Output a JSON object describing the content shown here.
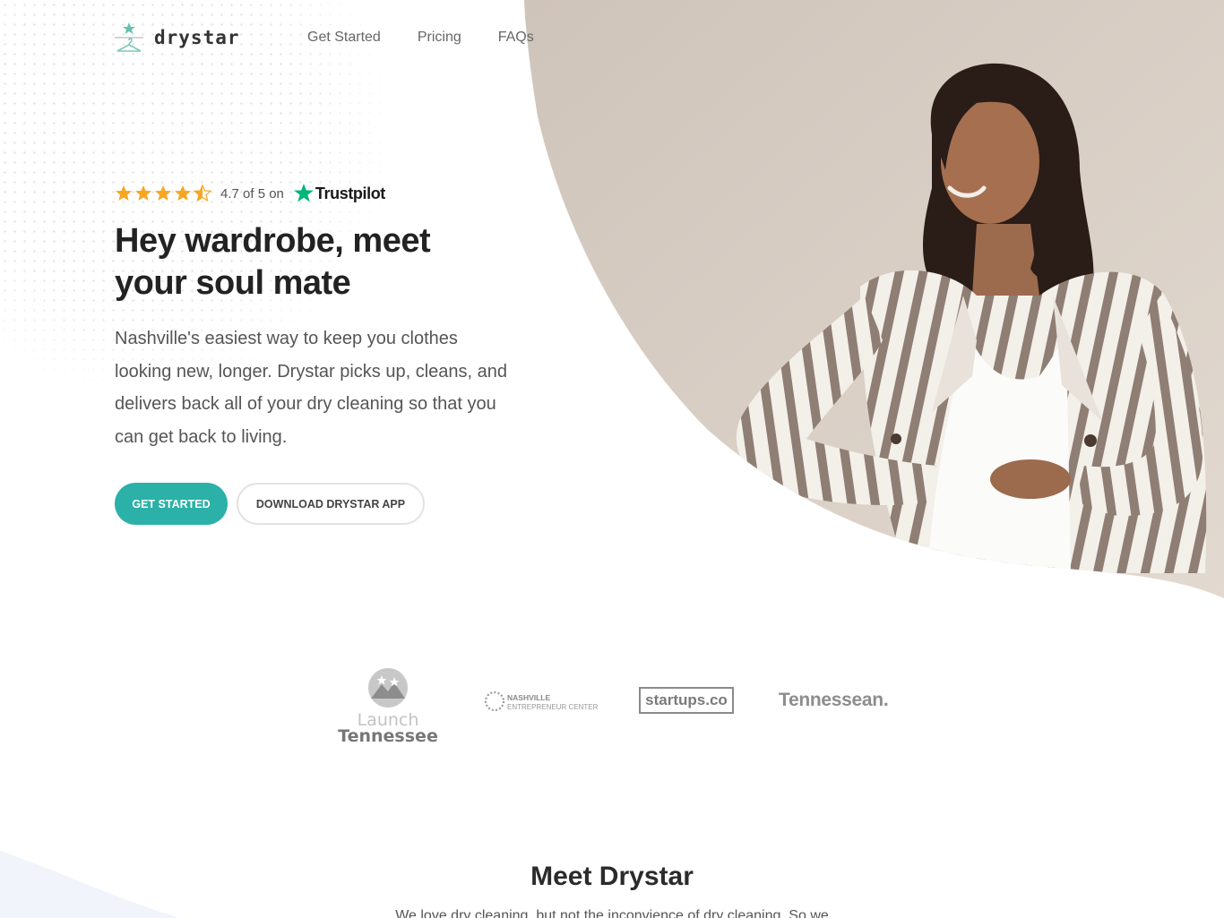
{
  "brand": {
    "name": "drystar",
    "accent": "#2bb1a7",
    "logo_icon": "hanger-star-icon"
  },
  "nav": {
    "items": [
      "Get Started",
      "Pricing",
      "FAQs"
    ]
  },
  "rating": {
    "stars": 4.5,
    "score_text": "4.7 of 5 on",
    "provider": "Trustpilot",
    "star_color": "#f6a623",
    "provider_color": "#00b67a"
  },
  "hero": {
    "headline": "Hey wardrobe, meet your soul mate",
    "description": "Nashville's easiest way to keep you clothes looking new, longer. Drystar picks up, cleans, and delivers back all of your dry cleaning so that you can get back to living.",
    "primary_cta": "GET STARTED",
    "secondary_cta": "DOWNLOAD DRYSTAR APP",
    "photo_bg": "#d9cec4"
  },
  "press_logos": [
    {
      "name": "launch-tennessee-logo",
      "lines": [
        "Launch",
        "Tennessee"
      ]
    },
    {
      "name": "nashville-entrepreneur-center-logo",
      "lines": [
        "NASHVILLE",
        "ENTREPRENEUR CENTER"
      ]
    },
    {
      "name": "startups-co-logo",
      "lines": [
        "startups.co"
      ]
    },
    {
      "name": "tennessean-logo",
      "lines": [
        "Tennessean."
      ]
    }
  ],
  "section": {
    "title": "Meet Drystar",
    "text": "We love dry cleaning, but not the inconvience of dry cleaning. So we"
  }
}
